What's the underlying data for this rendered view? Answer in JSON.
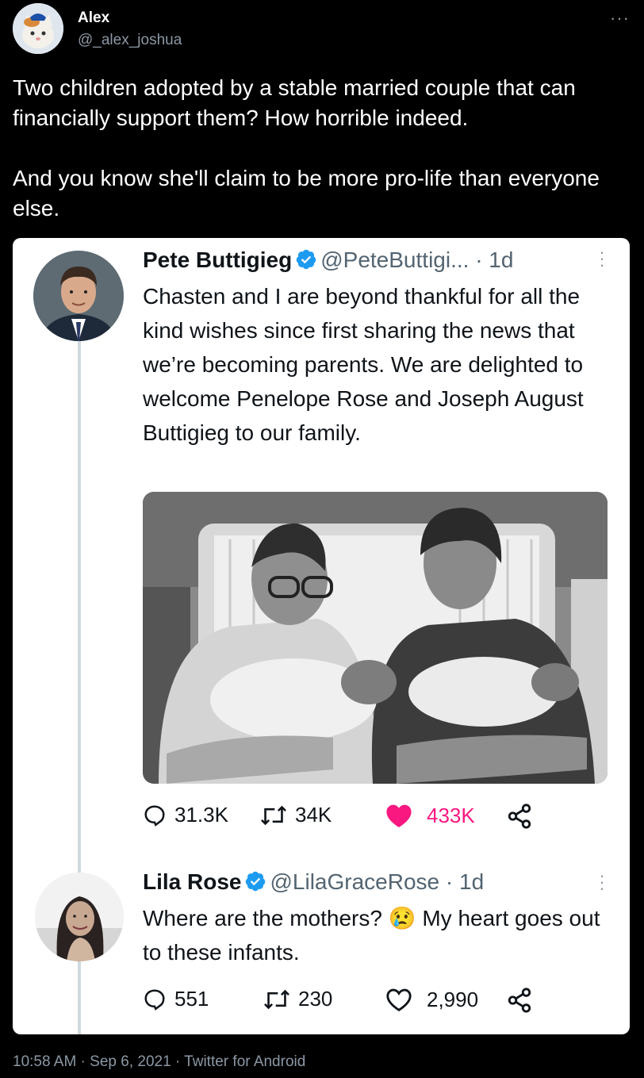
{
  "tweet": {
    "author_name": "Alex",
    "author_handle": "@_alex_joshua",
    "more_label": "···",
    "text": "Two children adopted by a stable married couple that can financially support them? How horrible indeed.\n\nAnd you know she'll claim to be more pro-life than everyone else.",
    "footer": "10:58 AM · Sep 6, 2021 · Twitter for Android"
  },
  "quote": {
    "author_name": "Pete Buttigieg",
    "author_handle": "@PeteButtigi... · 1d",
    "text": "Chasten and I are beyond thankful for all the kind wishes since first sharing the news that we’re becoming parents. We are delighted to welcome Penelope Rose and Joseph August Buttigieg to our family.",
    "replies": "31.3K",
    "retweets": "34K",
    "likes": "433K"
  },
  "reply": {
    "author_name": "Lila Rose",
    "author_handle": "@LilaGraceRose · 1d",
    "text_before": "Where are the mothers? ",
    "emoji": "😢",
    "text_after": " My heart goes out to these infants.",
    "replies": "551",
    "retweets": "230",
    "likes": "2,990"
  },
  "colors": {
    "verified": "#1d9bf0",
    "liked": "#f91880",
    "muted": "#8b98a5"
  }
}
